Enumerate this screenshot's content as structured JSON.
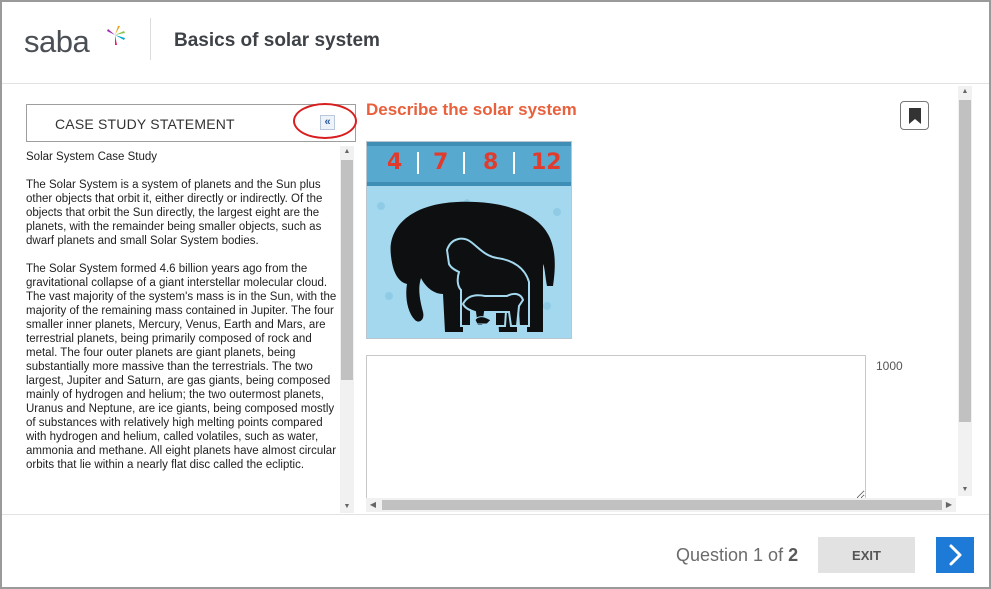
{
  "header": {
    "logo_text": "saba",
    "course_title": "Basics of solar system"
  },
  "case_study": {
    "title": "CASE STUDY STATEMENT",
    "collapse_glyph": "«",
    "heading": "Solar System Case Study",
    "paragraphs": [
      "The Solar System is a system of planets and the Sun plus other objects that orbit it, either directly or indirectly. Of the objects that orbit the Sun directly, the largest eight are the planets, with the remainder being smaller objects, such as dwarf planets and small Solar System bodies.",
      "The Solar System formed 4.6 billion years ago from the gravitational collapse of a giant interstellar molecular cloud. The vast majority of the system's mass is in the Sun, with the majority of the remaining mass contained in Jupiter. The four smaller inner planets, Mercury, Venus, Earth and Mars, are terrestrial planets, being primarily composed of rock and metal. The four outer planets are giant planets, being substantially more massive than the terrestrials. The two largest, Jupiter and Saturn, are gas giants, being composed mainly of hydrogen and helium; the two outermost planets, Uranus and Neptune, are ice giants, being composed mostly of substances with relatively high melting points compared with hydrogen and helium, called volatiles, such as water, ammonia and methane. All eight planets have almost circular orbits that lie within a nearly flat disc called the ecliptic."
    ]
  },
  "question": {
    "prompt": "Describe the solar system",
    "image_numbers": [
      "4",
      "7",
      "8",
      "12"
    ],
    "answer_value": "",
    "char_limit": "1000"
  },
  "footer": {
    "counter_prefix": "Question 1 of ",
    "counter_total": "2",
    "exit_label": "EXIT"
  },
  "colors": {
    "accent_orange": "#e8603c",
    "next_blue": "#1d7ad6",
    "highlight_red": "#d81e1e",
    "image_numbers_red": "#e13b2d"
  }
}
